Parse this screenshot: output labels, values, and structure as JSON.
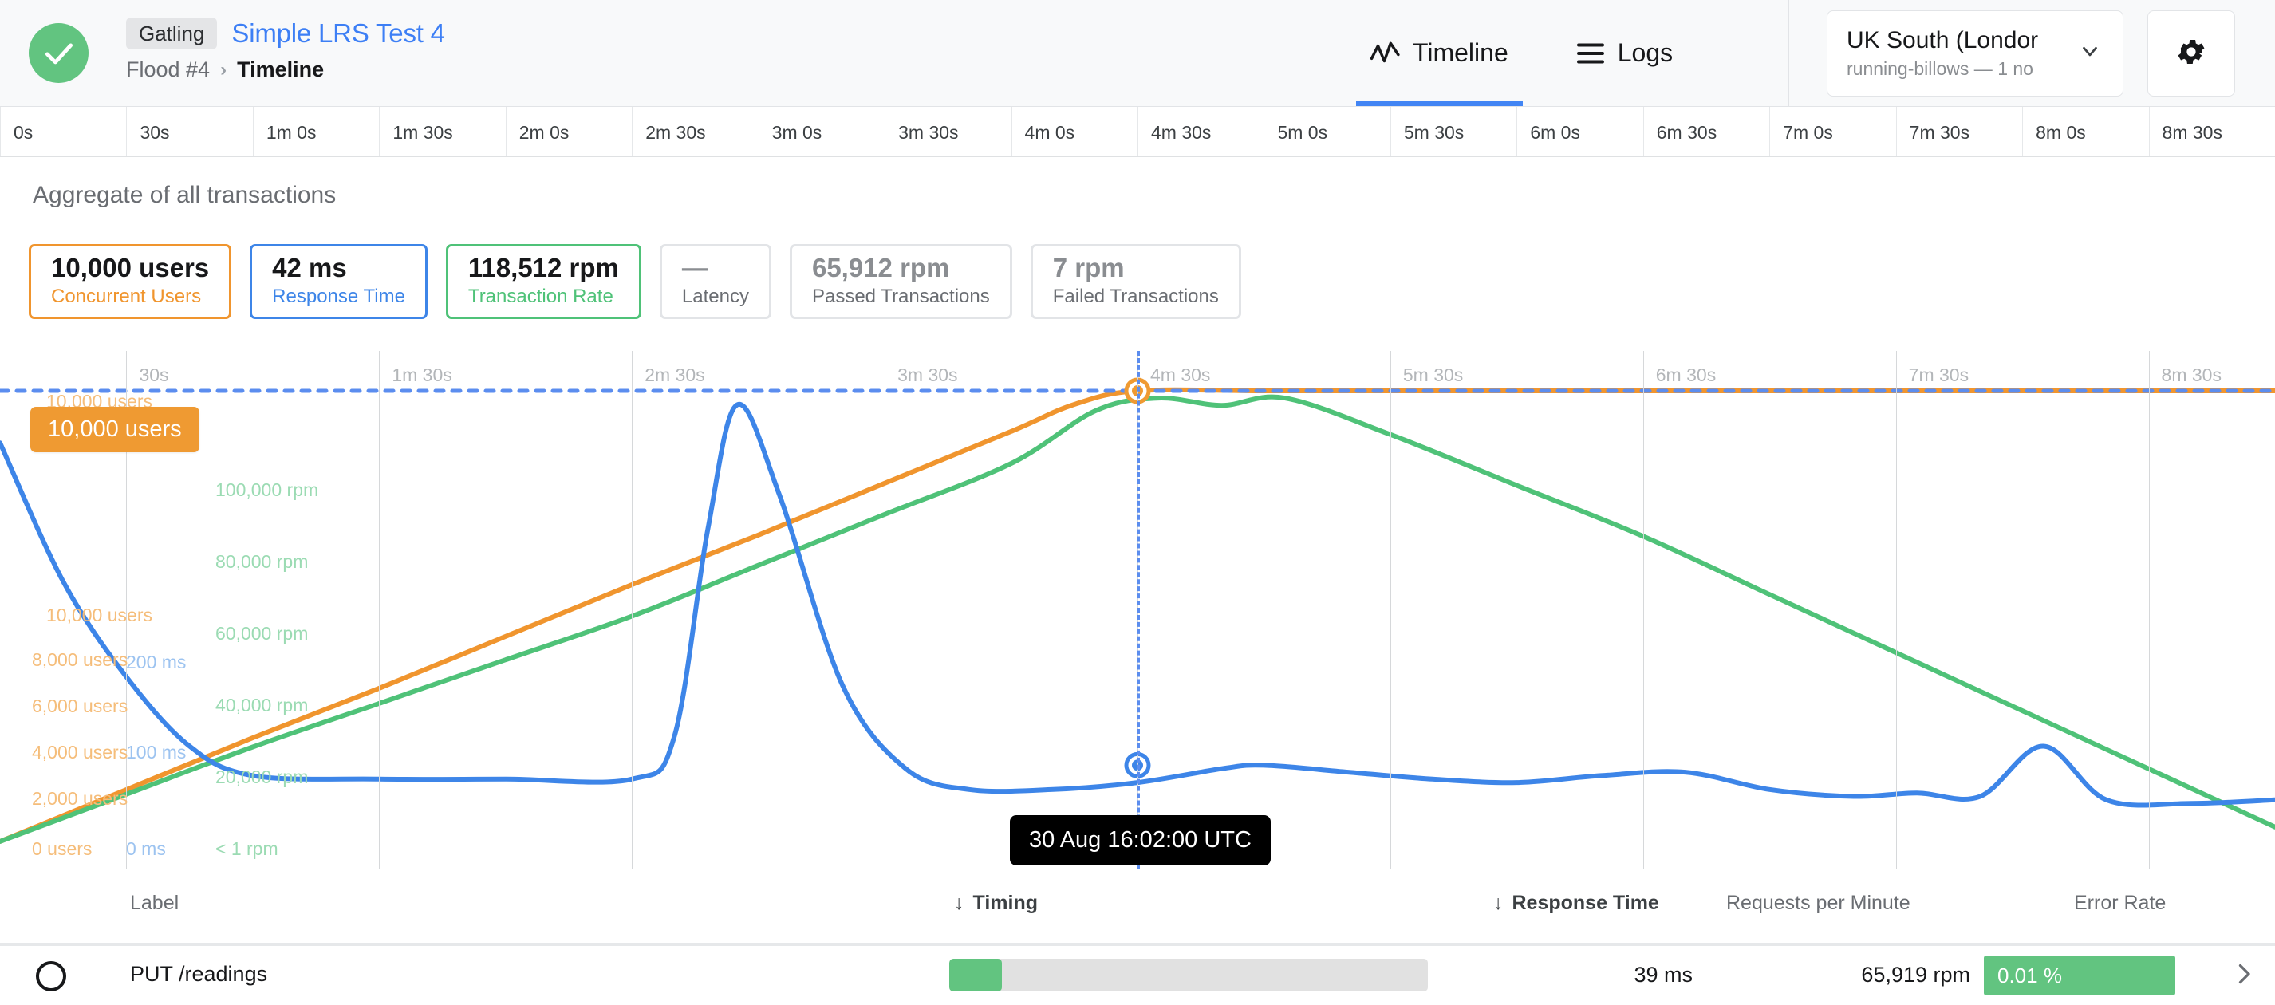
{
  "header": {
    "status_icon": "check-circle-icon",
    "status_color": "#62c480",
    "tag": "Gatling",
    "test_name": "Simple LRS Test 4",
    "breadcrumb_parent": "Flood #4",
    "breadcrumb_separator": "›",
    "breadcrumb_current": "Timeline",
    "tabs": [
      {
        "label": "Timeline",
        "icon": "activity-line-icon",
        "active": true
      },
      {
        "label": "Logs",
        "icon": "list-lines-icon",
        "active": false
      }
    ],
    "region": {
      "name": "UK South (Londor",
      "detail": "running-billows — 1 no",
      "caret_icon": "chevron-down-icon"
    },
    "settings_icon": "gear-icon"
  },
  "ruler": {
    "ticks": [
      "0s",
      "30s",
      "1m 0s",
      "1m 30s",
      "2m 0s",
      "2m 30s",
      "3m 0s",
      "3m 30s",
      "4m 0s",
      "4m 30s",
      "5m 0s",
      "5m 30s",
      "6m 0s",
      "6m 30s",
      "7m 0s",
      "7m 30s",
      "8m 0s",
      "8m 30s"
    ]
  },
  "aggregate_label": "Aggregate of all transactions",
  "stats": [
    {
      "value": "10,000 users",
      "label": "Concurrent Users",
      "accent": "orange"
    },
    {
      "value": "42 ms",
      "label": "Response Time",
      "accent": "blue"
    },
    {
      "value": "118,512 rpm",
      "label": "Transaction Rate",
      "accent": "green"
    },
    {
      "value": "—",
      "label": "Latency",
      "accent": "muted"
    },
    {
      "value": "65,912 rpm",
      "label": "Passed Transactions",
      "accent": "muted"
    },
    {
      "value": "7 rpm",
      "label": "Failed Transactions",
      "accent": "muted"
    }
  ],
  "chart_data": {
    "type": "line",
    "title": "Aggregate of all transactions",
    "xlabel": "",
    "grid": true,
    "legend_position": "none",
    "x_tick_labels": [
      "30s",
      "1m 30s",
      "2m 30s",
      "3m 30s",
      "4m 30s",
      "5m 30s",
      "6m 30s",
      "7m 30s",
      "8m 30s"
    ],
    "x_range_seconds": [
      0,
      540
    ],
    "axes": [
      {
        "name": "Concurrent Users",
        "color": "#f0952e",
        "tick_labels": [
          "0 users",
          "2,000 users",
          "4,000 users",
          "6,000 users",
          "8,000 users",
          "10,000 users"
        ],
        "ylim": [
          0,
          10000
        ]
      },
      {
        "name": "Response Time",
        "color": "#3d85e8",
        "tick_labels": [
          "0 ms",
          "100 ms",
          "200 ms"
        ],
        "ylim": [
          0,
          260
        ]
      },
      {
        "name": "Transaction Rate",
        "color": "#4fc278",
        "tick_labels": [
          "< 1 rpm",
          "20,000 rpm",
          "40,000 rpm",
          "60,000 rpm",
          "80,000 rpm",
          "100,000 rpm"
        ],
        "ylim": [
          0,
          124000
        ]
      }
    ],
    "threshold_line": {
      "label": "10,000 users",
      "value": 10000,
      "color": "#5b8def",
      "style": "dotted"
    },
    "badge": {
      "text": "10,000 users",
      "color": "#ef9a32"
    },
    "cursor": {
      "label": "30 Aug 16:02:00 UTC",
      "x_label": "4m 30s"
    },
    "series": [
      {
        "name": "Concurrent Users",
        "color": "#f0952e",
        "unit": "users",
        "x": [
          0,
          30,
          60,
          90,
          120,
          150,
          180,
          210,
          240,
          255,
          270,
          300,
          330,
          360,
          390,
          420,
          450,
          480,
          510,
          540
        ],
        "values": [
          0,
          1150,
          2300,
          3400,
          4550,
          5700,
          6800,
          7950,
          9100,
          9700,
          10000,
          10000,
          10000,
          10000,
          10000,
          10000,
          10000,
          10000,
          10000,
          10000
        ]
      },
      {
        "name": "Transaction Rate",
        "color": "#4fc278",
        "unit": "rpm",
        "x": [
          0,
          30,
          60,
          90,
          120,
          150,
          180,
          210,
          240,
          260,
          275,
          290,
          305,
          330,
          360,
          390,
          420,
          450,
          480,
          510,
          540
        ],
        "values": [
          0,
          13000,
          26000,
          38000,
          50000,
          62000,
          76000,
          90000,
          104000,
          118512,
          122000,
          120000,
          122000,
          112000,
          98000,
          84000,
          68000,
          52000,
          36000,
          20000,
          4000
        ]
      },
      {
        "name": "Response Time",
        "color": "#3d85e8",
        "unit": "ms",
        "x": [
          0,
          15,
          30,
          45,
          60,
          90,
          120,
          150,
          160,
          168,
          175,
          185,
          200,
          215,
          230,
          250,
          270,
          290,
          300,
          320,
          340,
          360,
          380,
          400,
          420,
          440,
          455,
          470,
          485,
          500,
          520,
          540
        ],
        "values": [
          230,
          150,
          95,
          55,
          38,
          36,
          36,
          36,
          60,
          180,
          252,
          200,
          90,
          42,
          30,
          30,
          34,
          42,
          44,
          40,
          36,
          34,
          38,
          40,
          30,
          26,
          28,
          26,
          55,
          24,
          22,
          24
        ]
      }
    ]
  },
  "table": {
    "columns": [
      {
        "label": "Label",
        "sorted": false
      },
      {
        "label": "Timing",
        "sorted": true,
        "sort_icon": "arrow-down-icon"
      },
      {
        "label": "Response Time",
        "sorted": true,
        "sort_icon": "arrow-down-icon"
      },
      {
        "label": "Requests per Minute",
        "sorted": false
      },
      {
        "label": "Error Rate",
        "sorted": false
      }
    ],
    "rows": [
      {
        "status_icon": "circle-outline-icon",
        "label": "PUT /readings",
        "timing_bar_percent": 11,
        "response_time": "39 ms",
        "requests_per_minute": "65,919 rpm",
        "error_rate": "0.01 %",
        "error_rate_color": "#62c480",
        "expand_icon": "chevron-right-icon"
      }
    ]
  }
}
